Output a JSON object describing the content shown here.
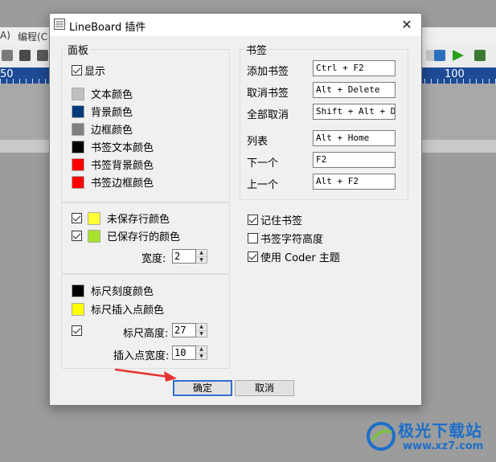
{
  "background": {
    "menu": [
      "A)",
      "编程(C"
    ],
    "ruler_numbers": [
      "50",
      "100"
    ]
  },
  "dialog": {
    "title": "LineBoard 插件",
    "close_glyph": "✕",
    "panel": {
      "title": "面板",
      "show_label": "显示",
      "show_checked": true,
      "colors": [
        {
          "label": "文本颜色",
          "color": "#c0c0c0"
        },
        {
          "label": "背景颜色",
          "color": "#003a7a"
        },
        {
          "label": "边框颜色",
          "color": "#808080"
        },
        {
          "label": "书签文本颜色",
          "color": "#000000"
        },
        {
          "label": "书签背景颜色",
          "color": "#ff0000"
        },
        {
          "label": "书签边框颜色",
          "color": "#ff0000"
        }
      ]
    },
    "lines": {
      "unsaved_label": "未保存行颜色",
      "unsaved_checked": true,
      "unsaved_color": "#ffff33",
      "saved_label": "已保存行的颜色",
      "saved_checked": true,
      "saved_color": "#a8e22a",
      "width_label": "宽度:",
      "width_value": "2"
    },
    "ruler": {
      "tick_color_label": "标尺刻度颜色",
      "tick_color": "#000000",
      "caret_color_label": "标尺插入点颜色",
      "caret_color": "#ffff00",
      "height_checked": true,
      "height_label": "标尺高度:",
      "height_value": "27",
      "caret_width_label": "插入点宽度:",
      "caret_width_value": "10"
    },
    "bookmarks": {
      "title": "书签",
      "items": [
        {
          "label": "添加书签",
          "hotkey": "Ctrl + F2"
        },
        {
          "label": "取消书签",
          "hotkey": "Alt + Delete"
        },
        {
          "label": "全部取消",
          "hotkey": "Shift + Alt + Del"
        },
        {
          "label": "列表",
          "hotkey": "Alt + Home"
        },
        {
          "label": "下一个",
          "hotkey": "F2"
        },
        {
          "label": "上一个",
          "hotkey": "Alt + F2"
        }
      ]
    },
    "options": [
      {
        "label": "记住书签",
        "checked": true
      },
      {
        "label": "书签字符高度",
        "checked": false
      },
      {
        "label": "使用 Coder 主题",
        "checked": true
      }
    ],
    "ok_label": "确定",
    "cancel_label": "取消"
  },
  "watermark": {
    "title": "极光下载站",
    "url": "www.xz7.com"
  }
}
